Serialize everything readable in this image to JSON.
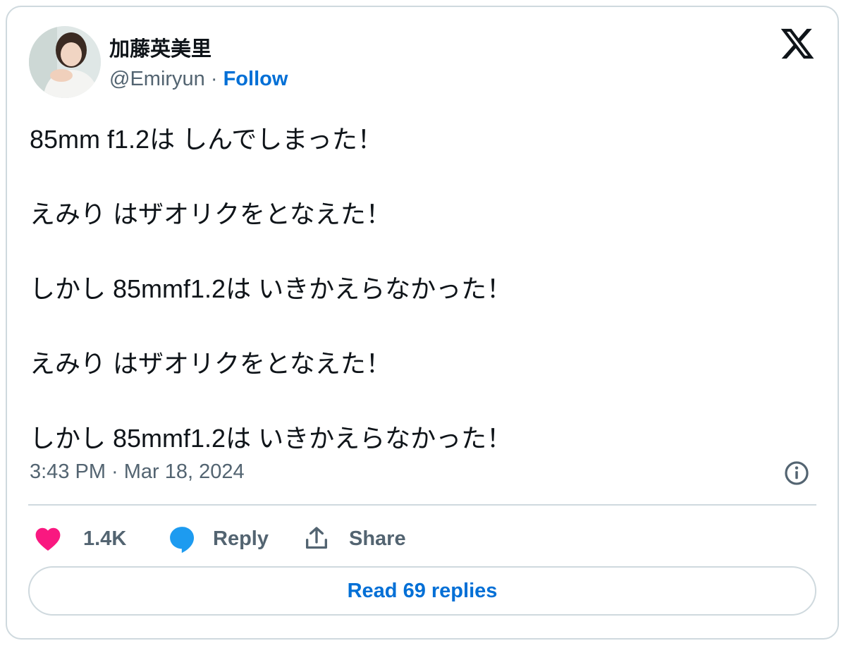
{
  "author": {
    "name": "加藤英美里",
    "handle": "@Emiryun",
    "separator": " · ",
    "follow_label": "Follow"
  },
  "tweet": {
    "lines": [
      "85mm f1.2は しんでしまった！",
      "えみり はザオリクをとなえた！",
      "しかし 85mmf1.2は いきかえらなかった！",
      "えみり はザオリクをとなえた！",
      "しかし 85mmf1.2は いきかえらなかった！"
    ],
    "timestamp": "3:43 PM · Mar 18, 2024"
  },
  "actions": {
    "like_count": "1.4K",
    "reply_label": "Reply",
    "share_label": "Share"
  },
  "footer": {
    "read_replies_label": "Read 69 replies"
  },
  "icons": {
    "brand": "x-logo-icon",
    "like": "heart-icon",
    "reply": "speech-bubble-icon",
    "share": "share-upload-icon",
    "info": "info-icon"
  },
  "colors": {
    "like": "#f91880",
    "reply": "#1d9bf0",
    "link": "#006fd6",
    "secondary_text": "#536471",
    "border": "#cfd9de"
  }
}
